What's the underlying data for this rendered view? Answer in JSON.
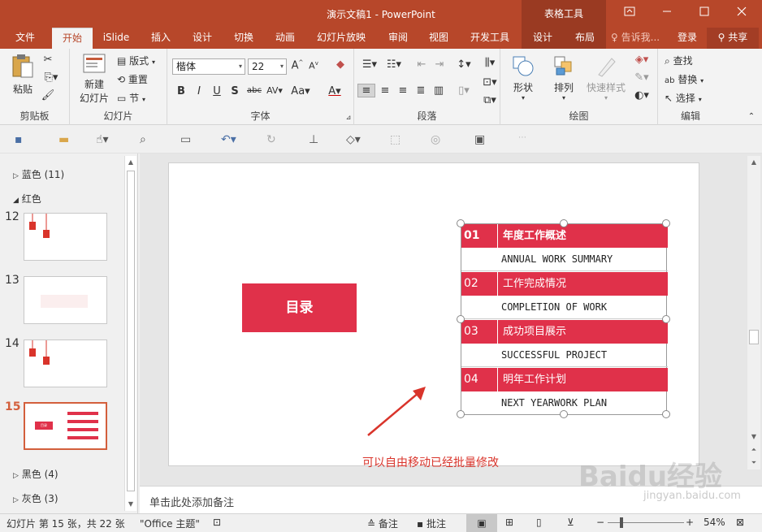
{
  "window": {
    "title": "演示文稿1 - PowerPoint",
    "context_tab_group": "表格工具",
    "controls": [
      "restore-ribbon",
      "minimize",
      "maximize",
      "close"
    ]
  },
  "tabs": [
    "文件",
    "开始",
    "iSlide",
    "插入",
    "设计",
    "切换",
    "动画",
    "幻灯片放映",
    "审阅",
    "视图",
    "开发工具",
    "设计",
    "布局"
  ],
  "active_tab": "开始",
  "tell_me": "告诉我...",
  "login": "登录",
  "share": "共享",
  "ribbon": {
    "clipboard": {
      "paste": "粘贴",
      "label": "剪贴板"
    },
    "slides": {
      "new_slide_line1": "新建",
      "new_slide_line2": "幻灯片",
      "layout": "版式",
      "reset": "重置",
      "section": "节",
      "label": "幻灯片"
    },
    "font": {
      "family": "楷体",
      "size": "22",
      "label": "字体"
    },
    "paragraph": {
      "label": "段落"
    },
    "drawing": {
      "shape": "形状",
      "arrange": "排列",
      "quick_styles": "快速样式",
      "label": "绘图"
    },
    "editing": {
      "find": "查找",
      "replace": "替换",
      "select": "选择",
      "label": "编辑"
    }
  },
  "thumbnails": {
    "sections": {
      "blue": "蓝色 (11)",
      "red": "红色",
      "black": "黑色 (4)",
      "gray": "灰色 (3)"
    },
    "slides": [
      {
        "num": "12"
      },
      {
        "num": "13"
      },
      {
        "num": "14"
      },
      {
        "num": "15",
        "selected": true
      }
    ],
    "thumb15_title": "目录"
  },
  "slide": {
    "title_box": "目录",
    "toc": [
      {
        "num": "01",
        "zh": "年度工作概述",
        "en": "ANNUAL WORK SUMMARY"
      },
      {
        "num": "02",
        "zh": "工作完成情况",
        "en": "COMPLETION OF WORK"
      },
      {
        "num": "03",
        "zh": "成功项目展示",
        "en": "SUCCESSFUL PROJECT"
      },
      {
        "num": "04",
        "zh": "明年工作计划",
        "en": "NEXT YEARWORK PLAN"
      }
    ],
    "annotation": "可以自由移动已经批量修改",
    "accent_color": "#e0314a",
    "annotation_color": "#d9342b"
  },
  "notes_placeholder": "单击此处添加备注",
  "status": {
    "slide_info": "幻灯片 第 15 张，共 22 张",
    "theme": "\"Office 主题\"",
    "notes": "备注",
    "comments": "批注",
    "zoom": "54%"
  },
  "watermark": {
    "text": "Baidu经验",
    "url": "jingyan.baidu.com"
  }
}
